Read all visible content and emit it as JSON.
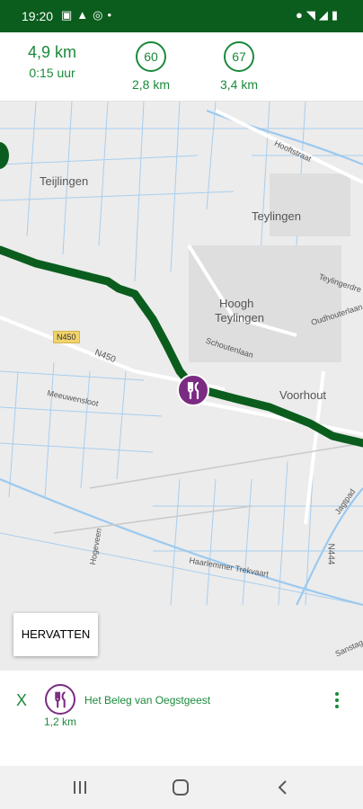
{
  "status_bar": {
    "time": "19:20",
    "left_icons": [
      "image-icon",
      "warning-icon",
      "sync-icon",
      "dot-icon"
    ],
    "right_icons": [
      "location-icon",
      "wifi-icon",
      "signal-icon",
      "battery-icon"
    ]
  },
  "route_summary": {
    "distance": "4,9 km",
    "duration": "0:15 uur",
    "nodes": [
      {
        "number": "60",
        "distance": "2,8 km"
      },
      {
        "number": "67",
        "distance": "3,4 km"
      }
    ]
  },
  "map": {
    "labels": {
      "teijlingen": "Teijlingen",
      "teylingen": "Teylingen",
      "hoogh_teylingen_1": "Hoogh",
      "hoogh_teylingen_2": "Teylingen",
      "voorhout": "Voorhout",
      "n450_badge": "N450",
      "n450_road": "N450",
      "n444": "N444",
      "hooftstraat": "Hooftstraat",
      "teylingerdreef": "Teylingerdre",
      "oudhouterlaan": "Oudhouterlaan",
      "schoutenlaan": "Schoutenlaan",
      "haarlemmer_trekvaart": "Haarlemmer Trekvaart",
      "jagtpad": "Jagtpad",
      "meeuwensloot": "Meeuwensloot",
      "hogeveen": "Hogeveen",
      "sanstag": "Sanstag"
    },
    "colors": {
      "route": "#0b5d1e",
      "water": "#9cc9ef",
      "poi": "#7b2b82",
      "background": "#ececec"
    },
    "poi_icon": "fork-knife-icon"
  },
  "resume_button": {
    "label": "HERVATTEN"
  },
  "poi_panel": {
    "close_label": "X",
    "icon": "fork-knife-icon",
    "distance": "1,2 km",
    "name": "Het Beleg van Oegstgeest",
    "menu_icon": "more-vert-icon"
  },
  "nav_bar": {
    "icons": [
      "recent-apps-icon",
      "home-icon",
      "back-icon"
    ]
  }
}
